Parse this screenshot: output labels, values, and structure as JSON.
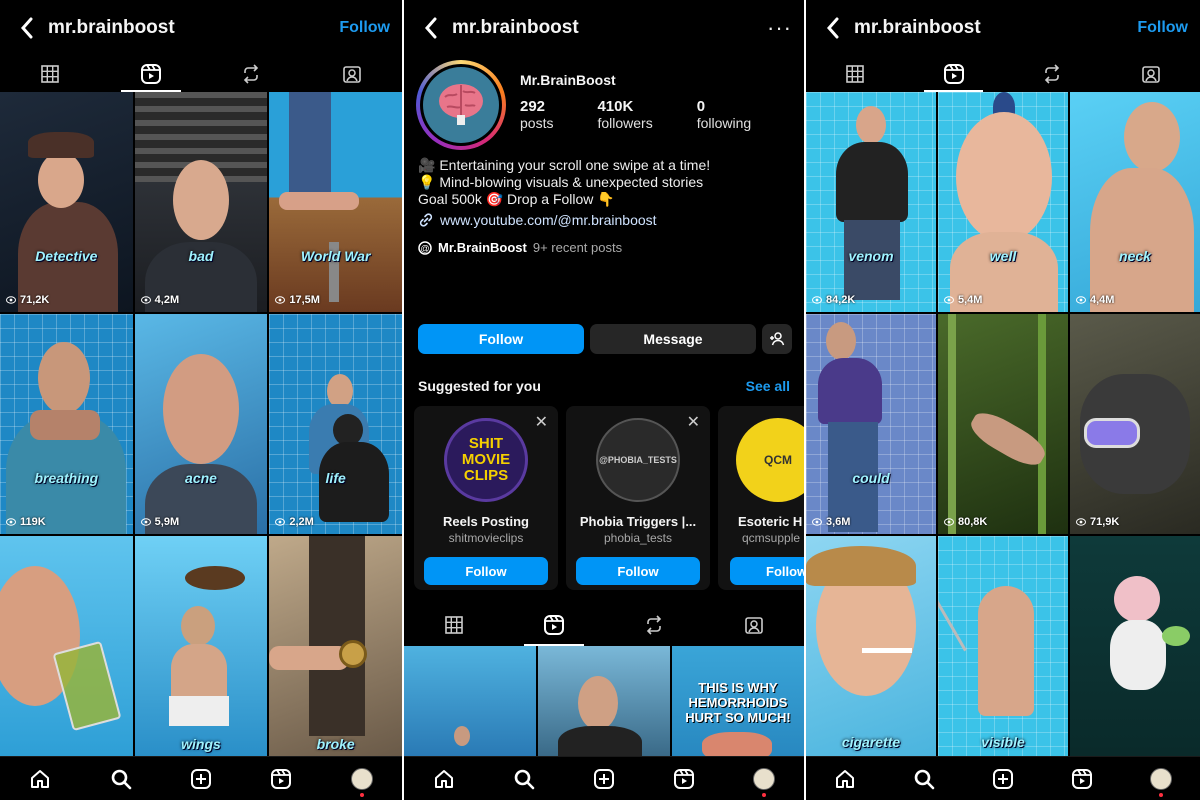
{
  "left": {
    "username": "mr.brainboost",
    "follow_label": "Follow",
    "reels": [
      {
        "label": "Detective",
        "views": "71,2K"
      },
      {
        "label": "bad",
        "views": "4,2M"
      },
      {
        "label": "World War",
        "views": "17,5M"
      },
      {
        "label": "breathing",
        "views": "119K"
      },
      {
        "label": "acne",
        "views": "5,9M"
      },
      {
        "label": "life",
        "views": "2,2M"
      },
      {
        "label": "",
        "views": ""
      },
      {
        "label": "wings",
        "views": ""
      },
      {
        "label": "broke",
        "views": ""
      }
    ]
  },
  "middle": {
    "username": "mr.brainboost",
    "more_label": "···",
    "display_name": "Mr.BrainBoost",
    "stats": [
      {
        "value": "292",
        "label": "posts"
      },
      {
        "value": "410K",
        "label": "followers"
      },
      {
        "value": "0",
        "label": "following"
      }
    ],
    "bio": [
      "🎥 Entertaining your scroll one swipe at a time!",
      "💡 Mind-blowing visuals & unexpected stories",
      "Goal 500k 🎯 Drop a Follow 👇"
    ],
    "link": "www.youtube.com/@mr.brainboost",
    "threads_name": "Mr.BrainBoost",
    "threads_recent": "9+ recent posts",
    "follow_button": "Follow",
    "message_button": "Message",
    "suggested_title": "Suggested for you",
    "see_all": "See all",
    "suggestions": [
      {
        "name": "Reels Posting",
        "handle": "shitmovieclips",
        "logo_text": "SHIT MOVIE CLIPS",
        "button": "Follow"
      },
      {
        "name": "Phobia Triggers |...",
        "handle": "phobia_tests",
        "logo_text": "@PHOBIA_TESTS",
        "button": "Follow"
      },
      {
        "name": "Esoteric H",
        "handle": "qcmsupple",
        "logo_text": "QCM",
        "button": "Follow"
      }
    ],
    "grid_text": "THIS IS WHY HEMORRHOIDS HURT SO MUCH!"
  },
  "right": {
    "username": "mr.brainboost",
    "follow_label": "Follow",
    "reels": [
      {
        "label": "venom",
        "views": "84,2K"
      },
      {
        "label": "well",
        "views": "5,4M"
      },
      {
        "label": "neck",
        "views": "4,4M"
      },
      {
        "label": "could",
        "views": "3,6M"
      },
      {
        "label": "",
        "views": "80,8K"
      },
      {
        "label": "",
        "views": "71,9K"
      },
      {
        "label": "cigarette",
        "views": ""
      },
      {
        "label": "visible",
        "views": ""
      },
      {
        "label": "",
        "views": ""
      }
    ]
  }
}
